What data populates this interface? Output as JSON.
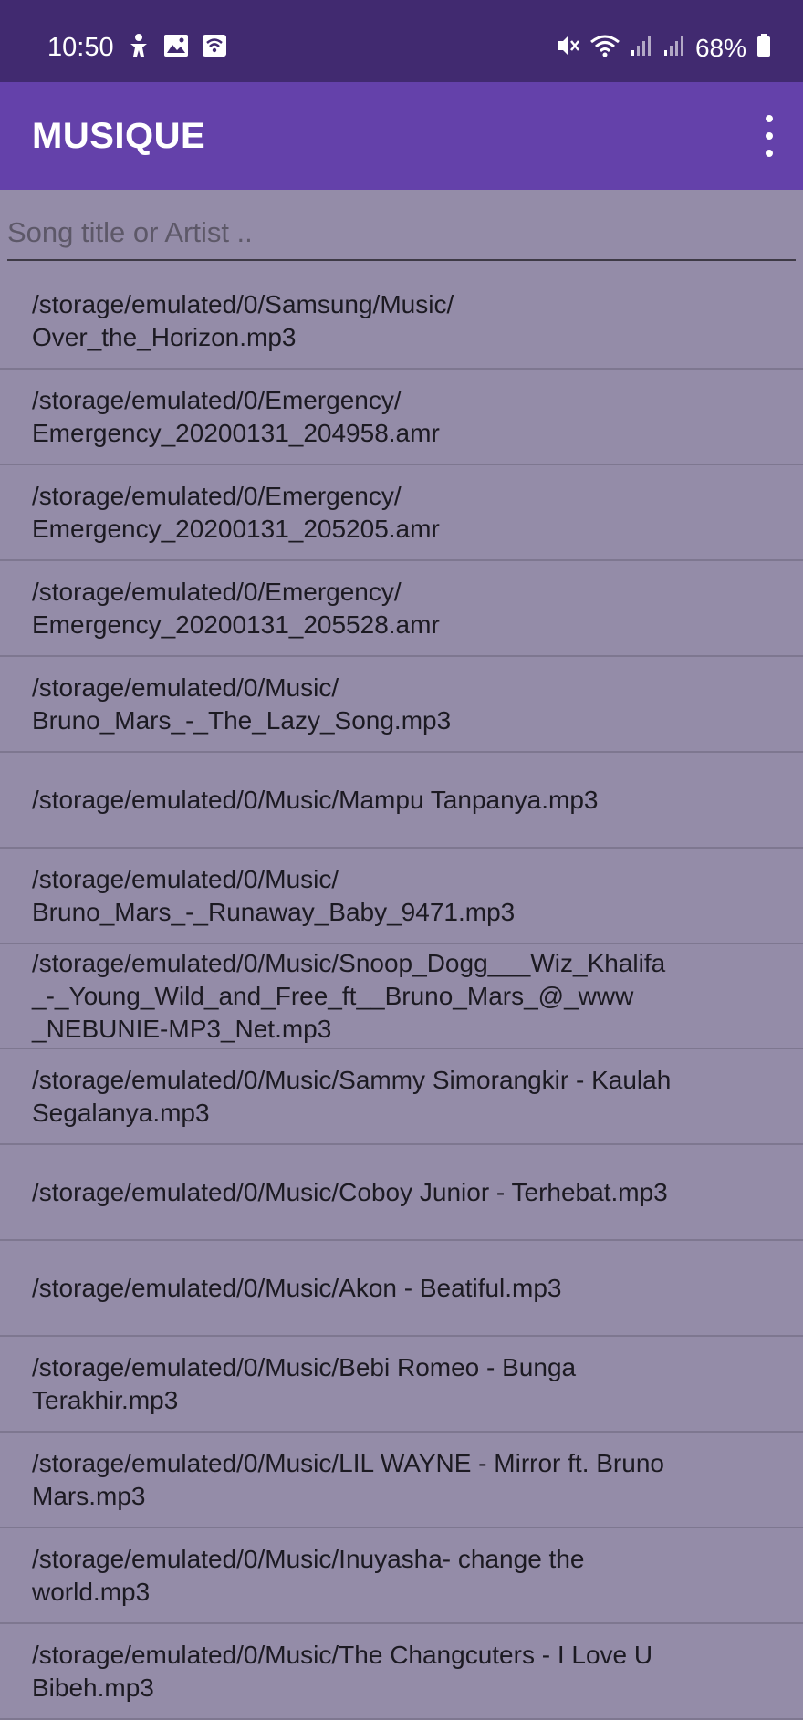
{
  "status_bar": {
    "time": "10:50",
    "battery": "68%",
    "left_icons": [
      "accessibility-icon",
      "gallery-icon",
      "wifi-call-icon"
    ],
    "right_icons": [
      "vibrate-off-icon",
      "wifi-icon",
      "signal-icon",
      "signal-icon",
      "battery-icon"
    ]
  },
  "app_bar": {
    "title": "MUSIQUE",
    "menu_icon": "overflow-menu-icon"
  },
  "search": {
    "placeholder": "Song title or Artist ..",
    "value": ""
  },
  "songs": [
    "/storage/emulated/0/Samsung/Music/\nOver_the_Horizon.mp3",
    "/storage/emulated/0/Emergency/\nEmergency_20200131_204958.amr",
    "/storage/emulated/0/Emergency/\nEmergency_20200131_205205.amr",
    "/storage/emulated/0/Emergency/\nEmergency_20200131_205528.amr",
    "/storage/emulated/0/Music/\nBruno_Mars_-_The_Lazy_Song.mp3",
    "/storage/emulated/0/Music/Mampu Tanpanya.mp3",
    "/storage/emulated/0/Music/\nBruno_Mars_-_Runaway_Baby_9471.mp3",
    "/storage/emulated/0/Music/Snoop_Dogg___Wiz_Khalifa\n_-_Young_Wild_and_Free_ft__Bruno_Mars_@_www\n_NEBUNIE-MP3_Net.mp3",
    "/storage/emulated/0/Music/Sammy Simorangkir - Kaulah\nSegalanya.mp3",
    "/storage/emulated/0/Music/Coboy Junior - Terhebat.mp3",
    "/storage/emulated/0/Music/Akon - Beatiful.mp3",
    "/storage/emulated/0/Music/Bebi Romeo - Bunga\nTerakhir.mp3",
    "/storage/emulated/0/Music/LIL WAYNE - Mirror ft. Bruno\nMars.mp3",
    "/storage/emulated/0/Music/Inuyasha- change the\nworld.mp3",
    "/storage/emulated/0/Music/The Changcuters - I Love U\nBibeh.mp3"
  ]
}
